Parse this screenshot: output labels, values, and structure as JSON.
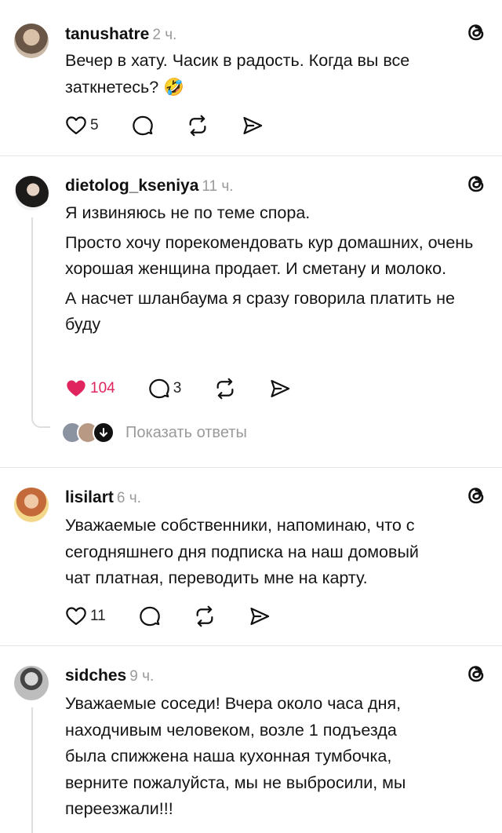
{
  "posts": [
    {
      "username": "tanushatre",
      "time": "2 ч.",
      "lines": [
        "Вечер в хату. Часик в радость. Когда вы все",
        "заткнетесь? 🤣"
      ],
      "likes": "5",
      "comments": "",
      "liked": false
    },
    {
      "username": "dietolog_kseniya",
      "time": "11 ч.",
      "paragraphs": [
        "Я извиняюсь не по теме спора.",
        "Просто хочу порекомендовать кур домашних, очень хорошая женщина продает.  И сметану и молоко.",
        "А насчет шланбаума я сразу говорила платить не буду"
      ],
      "likes": "104",
      "comments": "3",
      "liked": true,
      "show_replies": "Показать ответы"
    },
    {
      "username": "lisilart",
      "time": "6 ч.",
      "lines": [
        "Уважаемые собственники, напоминаю, что с",
        "сегодняшнего дня подписка на наш домовый",
        "чат платная, переводить мне на карту."
      ],
      "likes": "11",
      "comments": "",
      "liked": false
    },
    {
      "username": "sidches",
      "time": "9 ч.",
      "lines": [
        "Уважаемые соседи! Вчера около часа дня,",
        "находчивым человеком, возле 1 подъезда",
        "была спижжена наша кухонная тумбочка,",
        "верните пожалуйста, мы не выбросили, мы",
        "переезжали!!!"
      ]
    }
  ],
  "icons": {
    "like": "heart-icon",
    "comment": "comment-icon",
    "repost": "repost-icon",
    "share": "share-icon",
    "brand": "threads-logo-icon"
  },
  "colors": {
    "like_active": "#e0245e",
    "muted": "#9a9a9a",
    "divider": "#e4e4e4"
  }
}
